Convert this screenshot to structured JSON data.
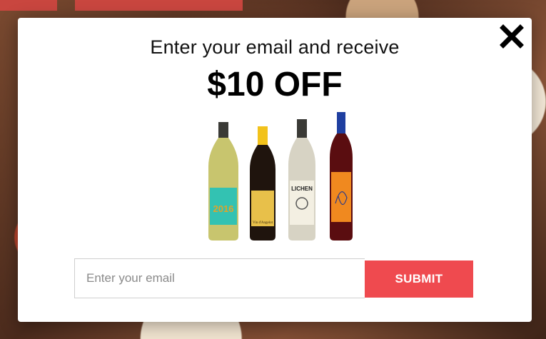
{
  "popup": {
    "headline": "Enter your email and receive",
    "offer": "$10 OFF",
    "email_placeholder": "Enter your email",
    "submit_label": "SUBMIT",
    "close_icon": "close-icon"
  },
  "bottles": [
    {
      "label_text": "2016"
    },
    {
      "label_text": "Vin d'Angelot"
    },
    {
      "label_text": "LICHEN"
    },
    {
      "label_text": ""
    }
  ],
  "colors": {
    "accent": "#ef4a4f",
    "modal_bg": "#ffffff",
    "text": "#111111"
  }
}
